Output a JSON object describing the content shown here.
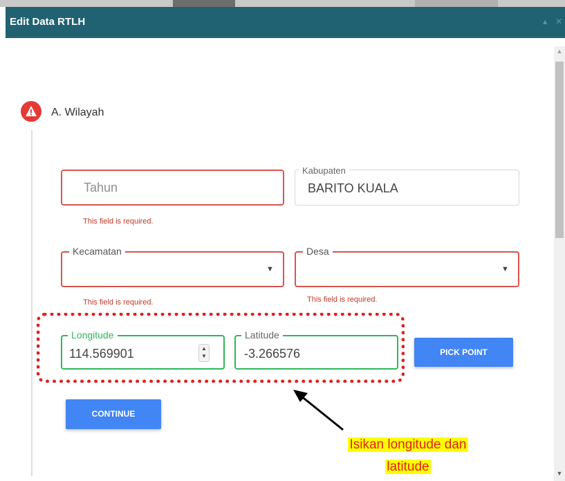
{
  "dialog": {
    "title": "Edit Data RTLH",
    "minimize_symbol": "▴",
    "close_symbol": "✕"
  },
  "step": {
    "icon": "warning-icon",
    "title": "A. Wilayah"
  },
  "form": {
    "tahun": {
      "placeholder": "Tahun",
      "error": "This field is required."
    },
    "kabupaten": {
      "label": "Kabupaten",
      "value": "BARITO KUALA"
    },
    "kecamatan": {
      "label": "Kecamatan",
      "value": "",
      "error": "This field is required."
    },
    "desa": {
      "label": "Desa",
      "value": "",
      "error": "This field is required."
    },
    "longitude": {
      "label": "Longitude",
      "value": "114.569901"
    },
    "latitude": {
      "label": "Latitude",
      "value": "-3.266576"
    },
    "pick_point_label": "PICK POINT",
    "continue_label": "CONTINUE"
  },
  "annotation": {
    "line1": "Isikan longitude dan",
    "line2": "latitude"
  },
  "colors": {
    "titlebar": "#216272",
    "error": "#d9534f",
    "success": "#2fb65a",
    "button": "#4285f4",
    "annotation_text": "#e02020",
    "annotation_bg": "#ffff00"
  }
}
